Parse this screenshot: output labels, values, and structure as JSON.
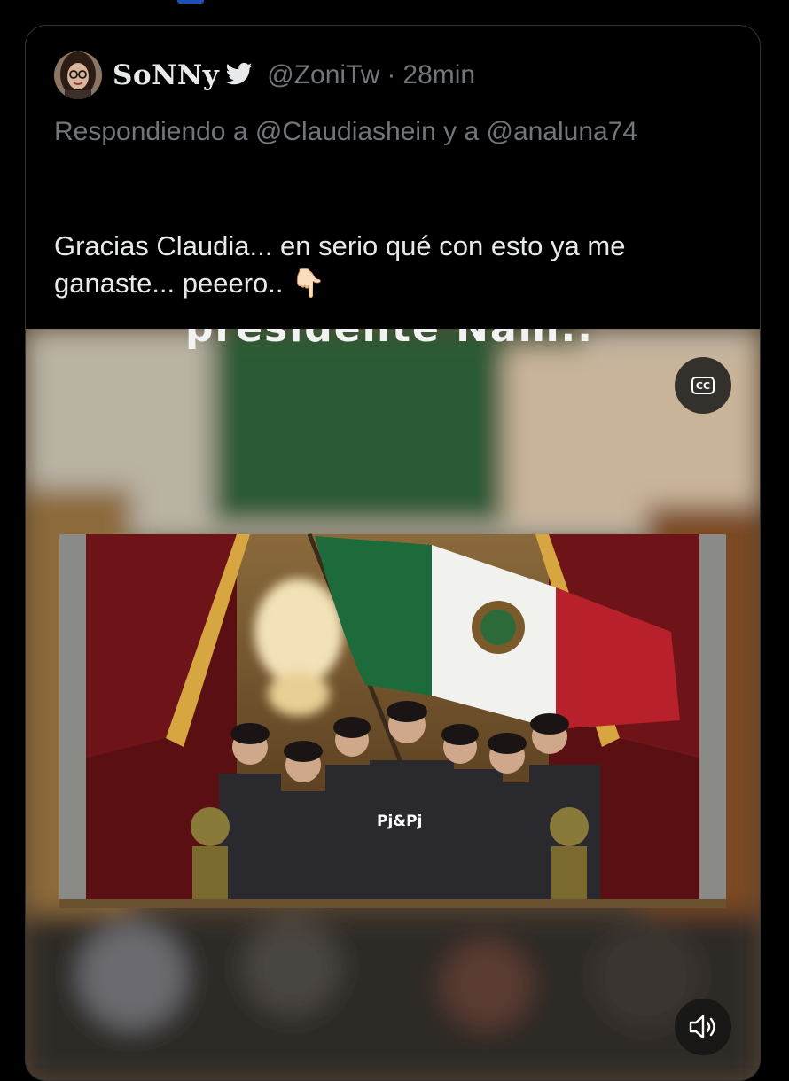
{
  "tweet": {
    "display_name": "SoNNy",
    "handle": "@ZoniTw",
    "separator": "·",
    "time": "28min",
    "reply_prefix": "Respondiendo a",
    "reply_mention_1": "@Claudiashein",
    "reply_joiner": "y a",
    "reply_mention_2": "@analuna74",
    "text": "Gracias Claudia... en serio qué con esto ya me ganaste... peeero..",
    "emoji": "👇🏻"
  },
  "media": {
    "caption": "presidente Nam..",
    "overlay_label": "Pj&Pj",
    "cc_label": "CC"
  },
  "colors": {
    "background": "#000000",
    "card_border": "#2f3336",
    "primary_text": "#e7e9ea",
    "secondary_text": "#71767b",
    "flag_green": "#1d6b3a",
    "flag_red": "#b8202b"
  },
  "icons": {
    "verified": "twitter-bird-icon",
    "captions": "closed-captions-icon",
    "volume": "speaker-icon"
  }
}
